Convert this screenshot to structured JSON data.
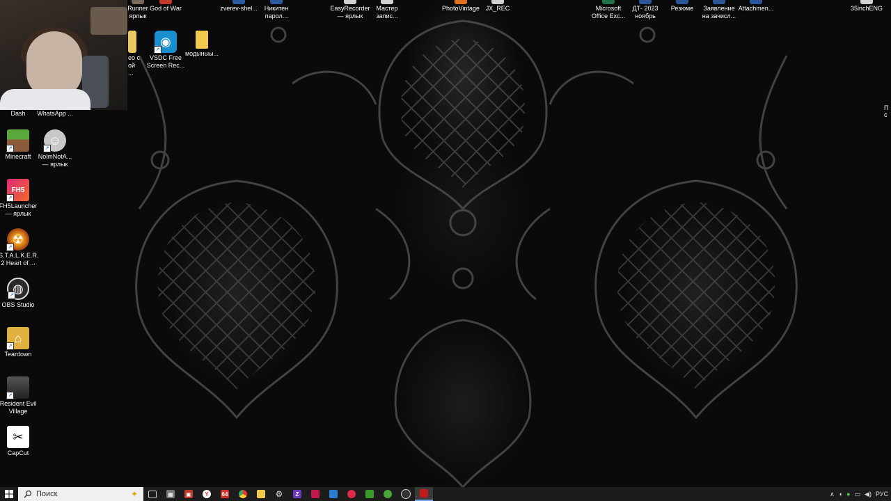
{
  "desktop": {
    "top_row": [
      {
        "label": "Runner\nярлык"
      },
      {
        "label": "God of War"
      },
      {
        "label": "zverev-shel..."
      },
      {
        "label": "Никитен\nпарол..."
      },
      {
        "label": "EasyRecorder\n— ярлык"
      },
      {
        "label": "Мастер\nзапис..."
      },
      {
        "label": "PhotoVintage"
      },
      {
        "label": "JX_REC"
      },
      {
        "label": "Microsoft\nOffice Exc..."
      },
      {
        "label": "ДТ- 2023\nноябрь"
      },
      {
        "label": "Резюме"
      },
      {
        "label": "Заявление\nна зачисл..."
      },
      {
        "label": "Attachmen..."
      },
      {
        "label": "35inchENG"
      }
    ],
    "second_row": [
      {
        "label": "ео с\nой ..."
      },
      {
        "label": "VSDC Free\nScreen Rec..."
      },
      {
        "label": "модыныы..."
      }
    ],
    "left_column": [
      {
        "label": "Dash",
        "icon": "dash-icon"
      },
      {
        "label": "WhatsApp ...",
        "icon": "whatsapp-icon"
      },
      {
        "label": "Minecraft",
        "icon": "minecraft-icon"
      },
      {
        "label": "NolmNotA...\n— ярлык",
        "icon": "nolmnota-icon"
      },
      {
        "label": "FH5Launcher\n— ярлык",
        "icon": "fh5-icon"
      },
      {
        "label": "S.T.A.L.K.E.R.\n2 Heart of ...",
        "icon": "stalker-icon"
      },
      {
        "label": "OBS Studio",
        "icon": "obs-icon"
      },
      {
        "label": "Teardown",
        "icon": "teardown-icon"
      },
      {
        "label": "Resident Evil\nVillage",
        "icon": "resident-evil-icon"
      },
      {
        "label": "CapCut",
        "icon": "capcut-icon"
      }
    ],
    "right_edge_text": "П\nс"
  },
  "taskbar": {
    "search_placeholder": "Поиск",
    "tray_language": "РУС",
    "pinned_64_label": "64"
  },
  "colors": {
    "taskbar_bg": "#1c1c1c",
    "search_bg": "#f0f0f0",
    "active_indicator": "#7aa7e0"
  }
}
